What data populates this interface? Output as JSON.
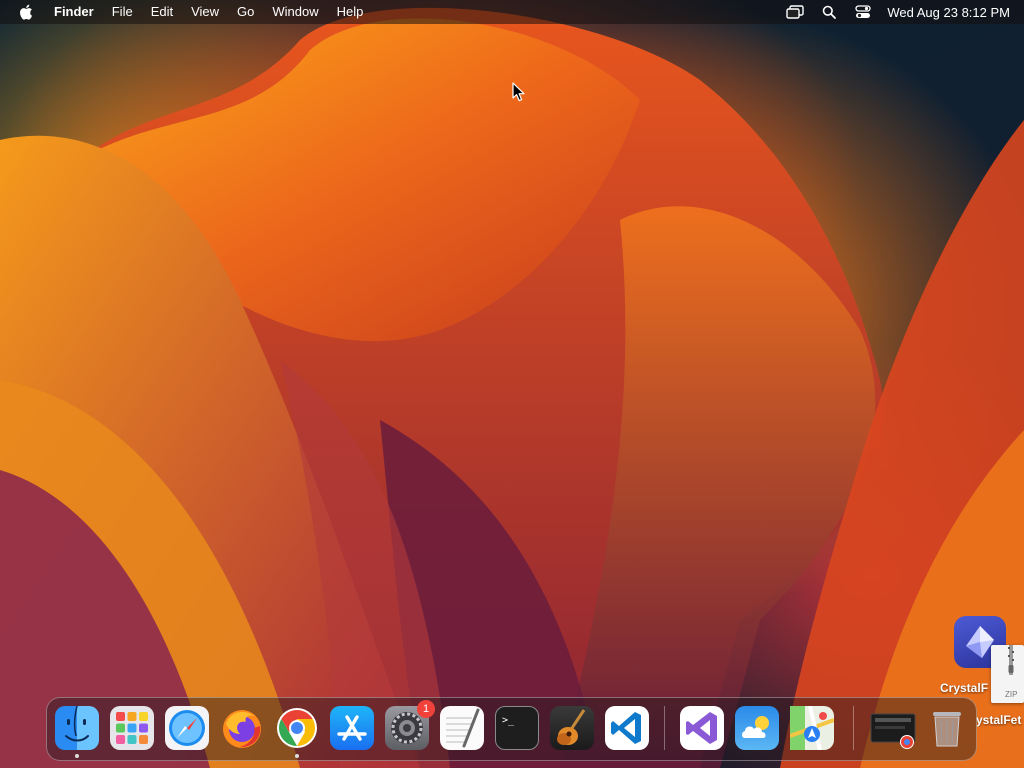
{
  "menubar": {
    "app_name": "Finder",
    "menus": [
      "File",
      "Edit",
      "View",
      "Go",
      "Window",
      "Help"
    ],
    "clock": "Wed Aug 23  8:12 PM",
    "status_icons": [
      "screen-mirroring-icon",
      "spotlight-search-icon",
      "control-center-icon"
    ]
  },
  "desktop": {
    "icons": [
      {
        "label": "CrystalF",
        "icon": "crystal-app-icon"
      },
      {
        "label": "ystalFet",
        "icon": "zip-file-icon",
        "badge": "ZIP"
      }
    ]
  },
  "dock": {
    "apps": [
      {
        "name": "Finder",
        "icon": "finder-icon",
        "running": true
      },
      {
        "name": "Launchpad",
        "icon": "launchpad-icon"
      },
      {
        "name": "Safari",
        "icon": "safari-icon"
      },
      {
        "name": "Firefox",
        "icon": "firefox-icon"
      },
      {
        "name": "Google Chrome",
        "icon": "chrome-icon",
        "running": true
      },
      {
        "name": "App Store",
        "icon": "app-store-icon"
      },
      {
        "name": "System Settings",
        "icon": "system-settings-icon",
        "badge": "1"
      },
      {
        "name": "TextEdit",
        "icon": "textedit-icon"
      },
      {
        "name": "Terminal",
        "icon": "terminal-icon"
      },
      {
        "name": "GarageBand",
        "icon": "garageband-icon"
      },
      {
        "name": "Visual Studio Code",
        "icon": "vscode-icon"
      },
      {
        "name": "Visual Studio",
        "icon": "visual-studio-icon"
      },
      {
        "name": "Weather",
        "icon": "weather-icon"
      },
      {
        "name": "Maps",
        "icon": "maps-icon"
      },
      {
        "name": "Downloads",
        "icon": "downloads-stack-icon"
      },
      {
        "name": "Trash",
        "icon": "trash-icon"
      }
    ]
  }
}
